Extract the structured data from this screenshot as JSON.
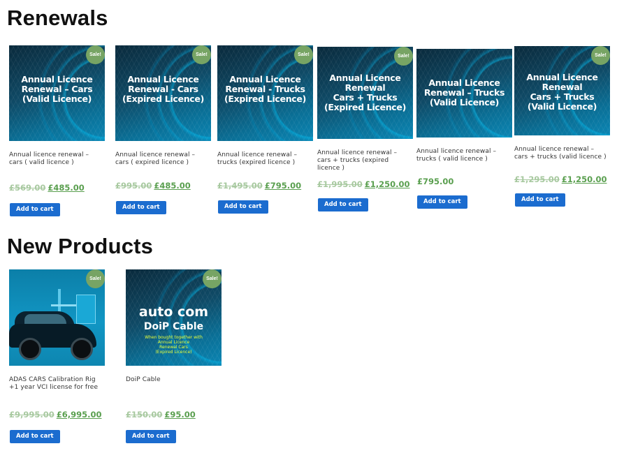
{
  "sections": {
    "renewals_title": "Renewals",
    "new_products_title": "New Products"
  },
  "sale_badge": "Sale!",
  "add_to_cart": "Add to cart",
  "renewals": [
    {
      "image_text": "Annual Licence\nRenewal – Cars\n(Valid Licence)",
      "name": "Annual licence renewal – cars ( valid licence )",
      "old_price": "£569.00",
      "price": "£485.00"
    },
    {
      "image_text": "Annual Licence\nRenewal - Cars\n(Expired Licence)",
      "name": "Annual licence renewal – cars ( expired licence )",
      "old_price": "£995.00",
      "price": "£485.00"
    },
    {
      "image_text": "Annual Licence\nRenewal - Trucks\n(Expired Licence)",
      "name": "Annual licence renewal – trucks (expired licence )",
      "old_price": "£1,495.00",
      "price": "£795.00"
    },
    {
      "image_text": "Annual Licence\nRenewal\nCars + Trucks\n(Expired Licence)",
      "name": "Annual licence renewal – cars + trucks (expired licence )",
      "old_price": "£1,995.00",
      "price": "£1,250.00"
    },
    {
      "image_text": "Annual Licence\nRenewal – Trucks\n(Valid Licence)",
      "name": "Annual licence renewal – trucks ( valid licence )",
      "old_price": "",
      "price": "£795.00"
    },
    {
      "image_text": "Annual Licence\nRenewal\nCars + Trucks\n(Valid Licence)",
      "name": "Annual licence renewal – cars + trucks (valid licence )",
      "old_price": "£1,295.00",
      "price": "£1,250.00"
    }
  ],
  "new_products": [
    {
      "name": "ADAS CARS Calibration Rig +1 year VCI license for free",
      "old_price": "£9,995.00",
      "price": "£6,995.00"
    },
    {
      "name": "DoiP Cable",
      "old_price": "£150.00",
      "price": "£95.00",
      "image_logo": "auto com",
      "image_title": "DoiP Cable",
      "image_note": "When bought together with\nAnnual Licence\nRenewal Cars\n(Expired Licence)"
    }
  ]
}
